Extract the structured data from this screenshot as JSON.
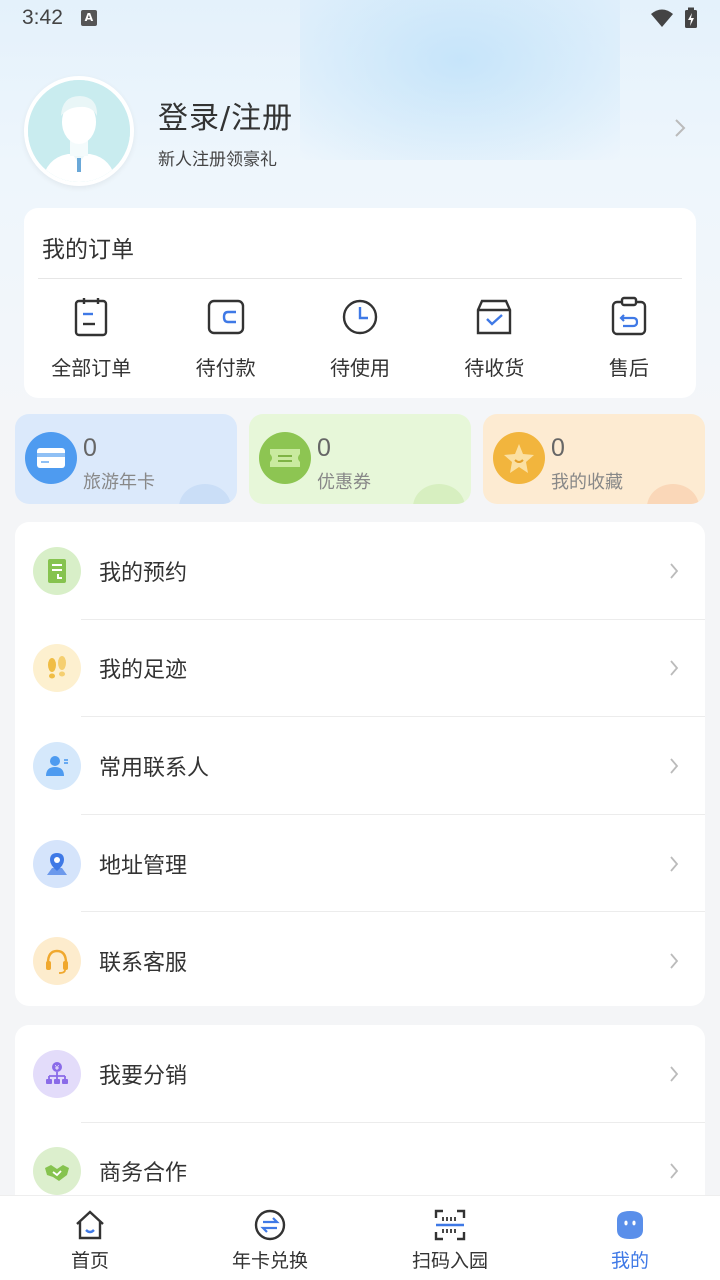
{
  "status": {
    "time": "3:42",
    "a_badge": "A"
  },
  "profile": {
    "title": "登录/注册",
    "subtitle": "新人注册领豪礼"
  },
  "orders": {
    "title": "我的订单",
    "items": [
      {
        "label": "全部订单",
        "icon": "clipboard-icon"
      },
      {
        "label": "待付款",
        "icon": "wallet-icon"
      },
      {
        "label": "待使用",
        "icon": "clock-icon"
      },
      {
        "label": "待收货",
        "icon": "box-check-icon"
      },
      {
        "label": "售后",
        "icon": "return-icon"
      }
    ]
  },
  "stats": [
    {
      "value": "0",
      "label": "旅游年卡",
      "color": "#4e9bf0"
    },
    {
      "value": "0",
      "label": "优惠券",
      "color": "#8dc552"
    },
    {
      "value": "0",
      "label": "我的收藏",
      "color": "#f2b53d"
    }
  ],
  "menu1": [
    {
      "label": "我的预约",
      "icon": "reservation-icon"
    },
    {
      "label": "我的足迹",
      "icon": "footprint-icon"
    },
    {
      "label": "常用联系人",
      "icon": "contact-icon"
    },
    {
      "label": "地址管理",
      "icon": "location-icon"
    },
    {
      "label": "联系客服",
      "icon": "headset-icon"
    }
  ],
  "menu2": [
    {
      "label": "我要分销",
      "icon": "distribution-icon"
    },
    {
      "label": "商务合作",
      "icon": "handshake-icon"
    }
  ],
  "tabs": [
    {
      "label": "首页",
      "icon": "home-icon"
    },
    {
      "label": "年卡兑换",
      "icon": "exchange-icon"
    },
    {
      "label": "扫码入园",
      "icon": "scan-icon"
    },
    {
      "label": "我的",
      "icon": "mine-icon",
      "active": true
    }
  ],
  "colors": {
    "accent": "#3f79e6",
    "text": "#333333"
  }
}
